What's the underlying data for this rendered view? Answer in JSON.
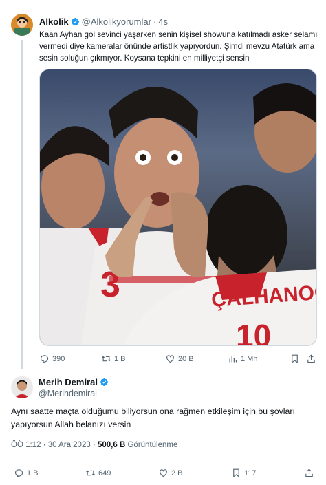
{
  "quoted_tweet": {
    "author_name": "Alkolik",
    "handle": "@Alkolikyorumlar",
    "separator": "·",
    "time": "4s",
    "text": "Kaan Ayhan gol sevinci yaşarken senin kişisel showuna katılmadı asker selamı vermedi diye kameralar önünde artistlik yapıyordun. Şimdi mevzu Atatürk ama sesin soluğun çıkmıyor. Koysana tepkini en milliyetçi sensin",
    "image_jersey_number": "3",
    "image_jersey_name": "ÇALHANOĞLU",
    "actions": {
      "replies": "390",
      "reposts": "1 B",
      "likes": "20 B",
      "views": "1 Mn"
    }
  },
  "main_tweet": {
    "author_name": "Merih Demiral",
    "handle": "@Merihdemiral",
    "text": "Aynı saatte maçta olduğumu biliyorsun ona rağmen etkileşim için bu şovları yapıyorsun Allah belanızı versin",
    "time": "ÖÖ 1:12",
    "separator": "·",
    "date": "30 Ara 2023",
    "views_count": "500,6 B",
    "views_label": "Görüntülenme",
    "actions": {
      "replies": "1 B",
      "reposts": "649",
      "likes": "2 B",
      "bookmarks": "117"
    }
  },
  "colors": {
    "text": "#0f1419",
    "muted": "#536471",
    "verified": "#1d9bf0",
    "divider": "#eff3f4"
  },
  "icons": [
    "verified-badge-icon",
    "reply-icon",
    "repost-icon",
    "like-icon",
    "views-icon",
    "bookmark-icon",
    "share-icon"
  ]
}
